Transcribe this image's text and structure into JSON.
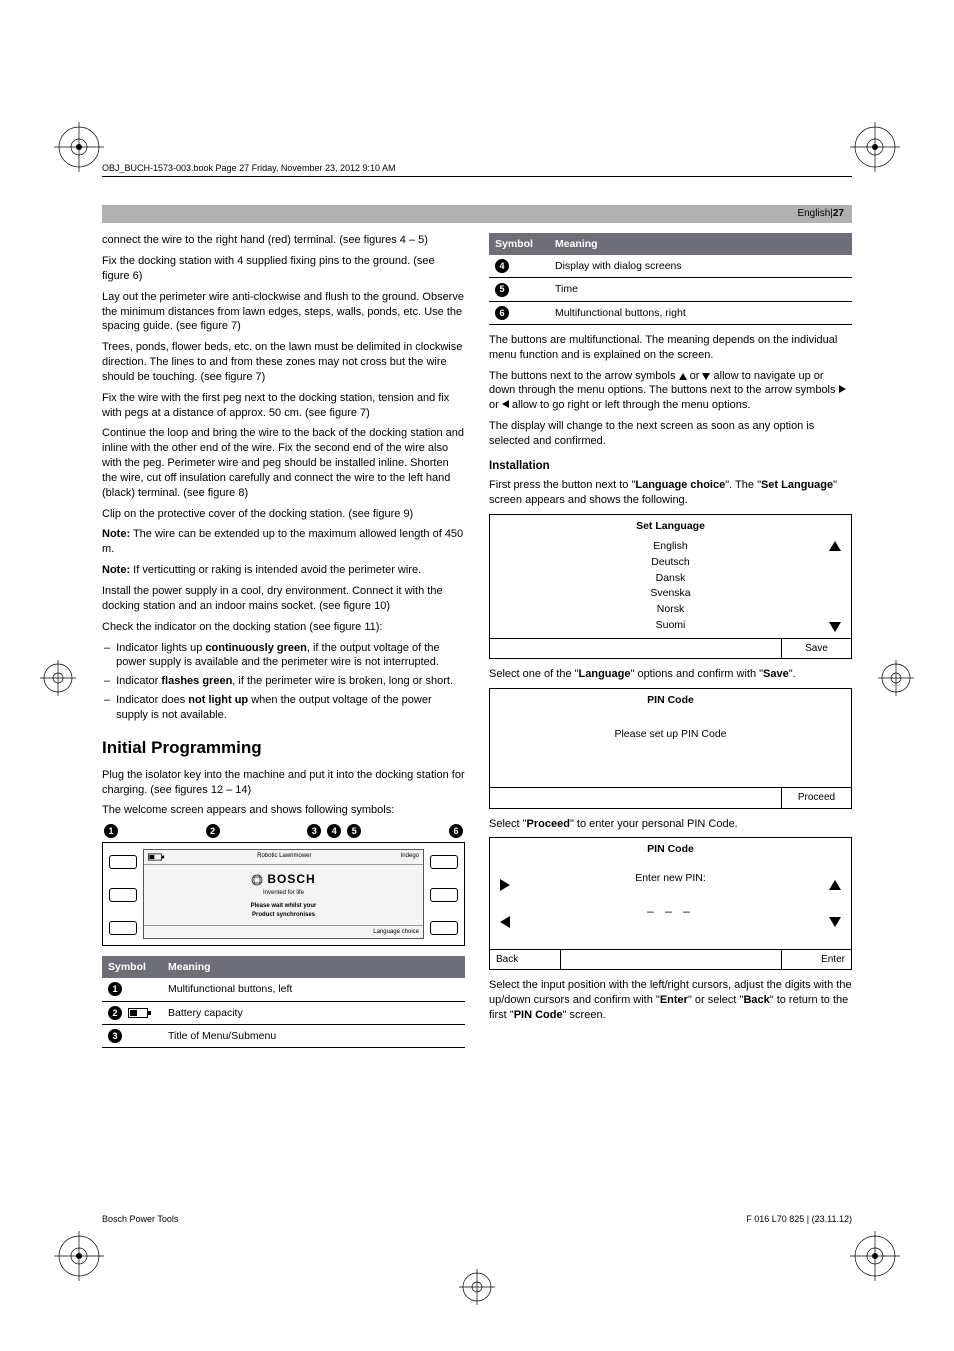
{
  "header_line": "OBJ_BUCH-1573-003.book  Page 27  Friday, November 23, 2012  9:10 AM",
  "top_bar": {
    "lang": "English",
    "sep": " | ",
    "page": "27"
  },
  "left": {
    "p1": "connect the wire to the right hand (red) terminal. (see figures 4 – 5)",
    "p2": "Fix the docking station with 4 supplied fixing pins to the ground. (see figure 6)",
    "p3": "Lay out the perimeter wire anti-clockwise and flush to the ground. Observe the minimum distances from lawn edges, steps, walls, ponds, etc. Use the spacing guide. (see figure 7)",
    "p4": "Trees, ponds, flower beds, etc. on the lawn must be delimited in clockwise direction. The lines to and from these zones may not cross but the wire should be touching. (see figure 7)",
    "p5": "Fix the wire with the first peg next to the docking station, tension and fix with pegs at a distance of approx. 50 cm. (see figure 7)",
    "p6": "Continue the loop and bring the wire to the back of the docking station and inline with the other end of the wire. Fix the second end of the wire also with the peg. Perimeter wire and peg should be installed inline. Shorten the wire, cut off insulation carefully and connect the wire to the left hand (black) terminal. (see figure 8)",
    "p7": "Clip on the protective cover of the docking station. (see figure 9)",
    "note1_label": "Note:",
    "note1": " The wire can be extended up to the maximum allowed length of 450 m.",
    "note2_label": "Note:",
    "note2": " If verticutting or raking is intended avoid the perimeter wire.",
    "p8": "Install the power supply in a cool, dry environment. Connect it with the docking station and an indoor mains socket. (see figure 10)",
    "p9": "Check the indicator on the docking station (see figure 11):",
    "b1a": "Indicator lights up ",
    "b1b": "continuously green",
    "b1c": ", if the output voltage of the power supply is available and the perimeter wire is not interrupted.",
    "b2a": "Indicator ",
    "b2b": "flashes green",
    "b2c": ", if the perimeter wire is broken, long or short.",
    "b3a": "Indicator does ",
    "b3b": "not light up",
    "b3c": " when the output voltage of the power supply is not available.",
    "h2": "Initial Programming",
    "ip1": "Plug the isolator key into the machine and put it into the docking station for charging. (see figures 12 – 14)",
    "ip2": "The welcome screen appears and shows following symbols:",
    "welcome": {
      "row1_left": "",
      "row1_mid": "Robotic Lawnmower",
      "row1_right": "Indego",
      "brand": "BOSCH",
      "tag": "Invented for life",
      "wait1": "Please wait whilst your",
      "wait2": "Product synchronises",
      "langchoice": "Language choice"
    },
    "table": {
      "h1": "Symbol",
      "h2": "Meaning",
      "rows": [
        {
          "n": "1",
          "icon": "",
          "m": "Multifunctional buttons, left"
        },
        {
          "n": "2",
          "icon": "batt",
          "m": "Battery capacity"
        },
        {
          "n": "3",
          "icon": "",
          "m": "Title of Menu/Submenu"
        }
      ]
    }
  },
  "right": {
    "table": {
      "h1": "Symbol",
      "h2": "Meaning",
      "rows": [
        {
          "n": "4",
          "m": "Display with dialog screens"
        },
        {
          "n": "5",
          "m": "Time"
        },
        {
          "n": "6",
          "m": "Multifunctional buttons, right"
        }
      ]
    },
    "p1": "The buttons are multifunctional. The meaning depends on the individual menu function and is explained on the screen.",
    "p2a": "The buttons next to the arrow symbols ",
    "p2b": " or ",
    "p2c": " allow to navigate up or down through the menu options. The buttons next to the arrow symbols ",
    "p2d": " or ",
    "p2e": " allow to go right or left through the menu options.",
    "p3": "The display will change to the next screen as soon as any option is selected and confirmed.",
    "h3": "Installation",
    "inst1a": "First press the button next to \"",
    "inst1b": "Language choice",
    "inst1c": "\". The \"",
    "inst1d": "Set Language",
    "inst1e": "\" screen appears and shows the following.",
    "dlg_lang": {
      "title": "Set Language",
      "items": [
        "English",
        "Deutsch",
        "Dansk",
        "Svenska",
        "Norsk",
        "Suomi"
      ],
      "save": "Save"
    },
    "sel1a": "Select one of the \"",
    "sel1b": "Language",
    "sel1c": "\" options and confirm with \"",
    "sel1d": "Save",
    "sel1e": "\".",
    "dlg_pin1": {
      "title": "PIN Code",
      "body": "Please set up PIN Code",
      "proceed": "Proceed"
    },
    "sel2a": "Select \"",
    "sel2b": "Proceed",
    "sel2c": "\" to enter your personal PIN Code.",
    "dlg_pin2": {
      "title": "PIN Code",
      "prompt": "Enter new PIN:",
      "slots": "– – –",
      "back": "Back",
      "enter": "Enter"
    },
    "sel3a": "Select the input position with the left/right cursors, adjust the digits with the up/down cursors and confirm with \"",
    "sel3b": "Enter",
    "sel3c": "\" or select \"",
    "sel3d": "Back",
    "sel3e": "\" to return to the first \"",
    "sel3f": "PIN Code",
    "sel3g": "\" screen."
  },
  "footer": {
    "left": "Bosch Power Tools",
    "right": "F 016 L70 825 | (23.11.12)"
  }
}
